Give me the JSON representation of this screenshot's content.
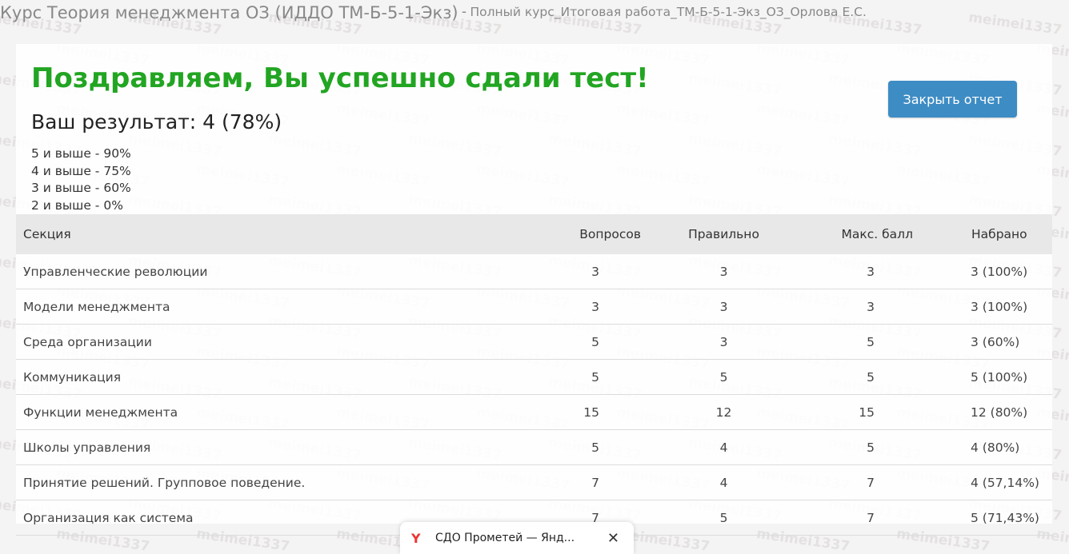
{
  "header": {
    "course_title": "Курс Теория менеджмента ОЗ (ИДДО ТМ-Б-5-1-Экз)",
    "separator": "-",
    "subtitle": "Полный курс_Итоговая работа_ТМ-Б-5-1-Экз_ОЗ_Орлова Е.С."
  },
  "report": {
    "title": "Поздравляем, Вы успешно сдали тест!",
    "result": "Ваш результат: 4 (78%)",
    "grades": [
      "5 и выше - 90%",
      "4 и выше - 75%",
      "3 и выше - 60%",
      "2 и выше - 0%"
    ],
    "close_label": "Закрыть отчет"
  },
  "table": {
    "columns": [
      "Секция",
      "Вопросов",
      "Правильно",
      "Макс. балл",
      "Набрано"
    ],
    "rows": [
      [
        "Управленческие революции",
        "3",
        "3",
        "3",
        "3 (100%)"
      ],
      [
        "Модели менеджмента",
        "3",
        "3",
        "3",
        "3 (100%)"
      ],
      [
        "Среда организации",
        "5",
        "3",
        "5",
        "3 (60%)"
      ],
      [
        "Коммуникация",
        "5",
        "5",
        "5",
        "5 (100%)"
      ],
      [
        "Функции менеджмента",
        "15",
        "12",
        "15",
        "12 (80%)"
      ],
      [
        "Школы управления",
        "5",
        "4",
        "5",
        "4 (80%)"
      ],
      [
        "Принятие решений. Групповое поведение.",
        "7",
        "4",
        "7",
        "4 (57,14%)"
      ],
      [
        "Организация как система",
        "7",
        "5",
        "7",
        "5 (71,43%)"
      ]
    ]
  },
  "taskbar": {
    "icon": "yandex-browser-icon",
    "label": "СДО Прометей — Янд...",
    "close_symbol": "✕"
  },
  "watermark": {
    "text": "meimei1337"
  },
  "colors": {
    "success": "#22a522",
    "button": "#3e8cc4",
    "header_text": "#888888"
  }
}
